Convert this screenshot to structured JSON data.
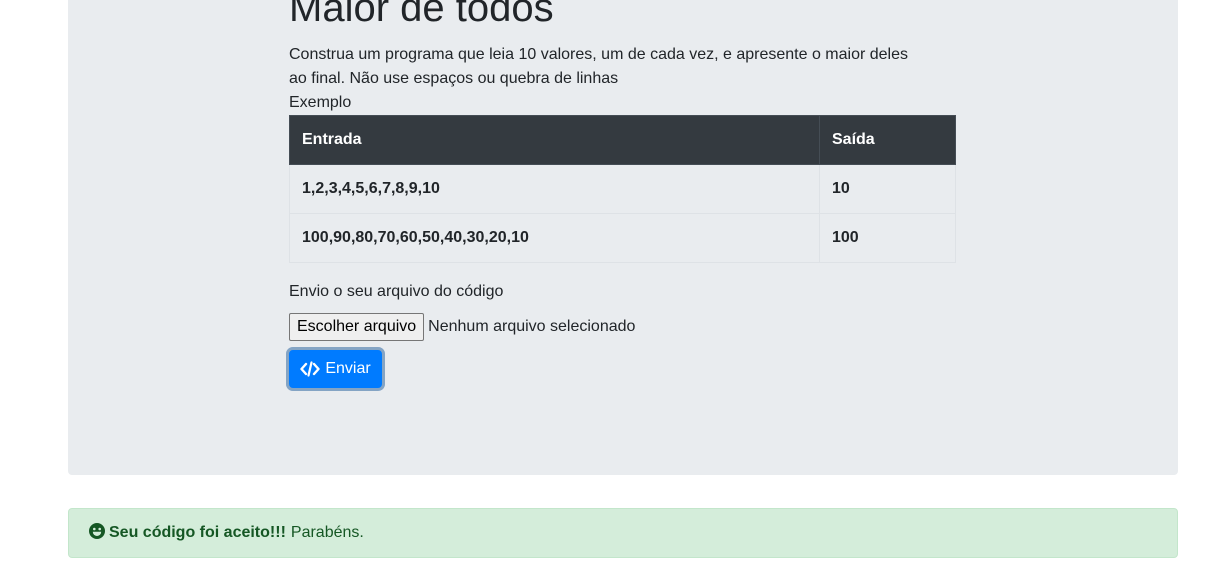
{
  "problem": {
    "title": "Maior de todos",
    "description": "Construa um programa que leia 10 valores, um de cada vez, e apresente o maior deles ao final. Não use espaços ou quebra de linhas",
    "example_label": "Exemplo"
  },
  "example_table": {
    "headers": [
      "Entrada",
      "Saída"
    ],
    "rows": [
      [
        "1,2,3,4,5,6,7,8,9,10",
        "10"
      ],
      [
        "100,90,80,70,60,50,40,30,20,10",
        "100"
      ]
    ]
  },
  "upload": {
    "label": "Envio o seu arquivo do código",
    "choose_button": "Escolher arquivo",
    "file_status": "Nenhum arquivo selecionado",
    "submit_label": "Enviar",
    "submit_icon": "code-icon"
  },
  "alert": {
    "icon": "smile-icon",
    "strong_text": "Seu código foi aceito!!!",
    "message": "Parabéns.",
    "color": "#155724",
    "background": "#d4edda"
  },
  "colors": {
    "primary": "#007bff",
    "table_header": "#343a40",
    "panel": "#e9ecef"
  }
}
